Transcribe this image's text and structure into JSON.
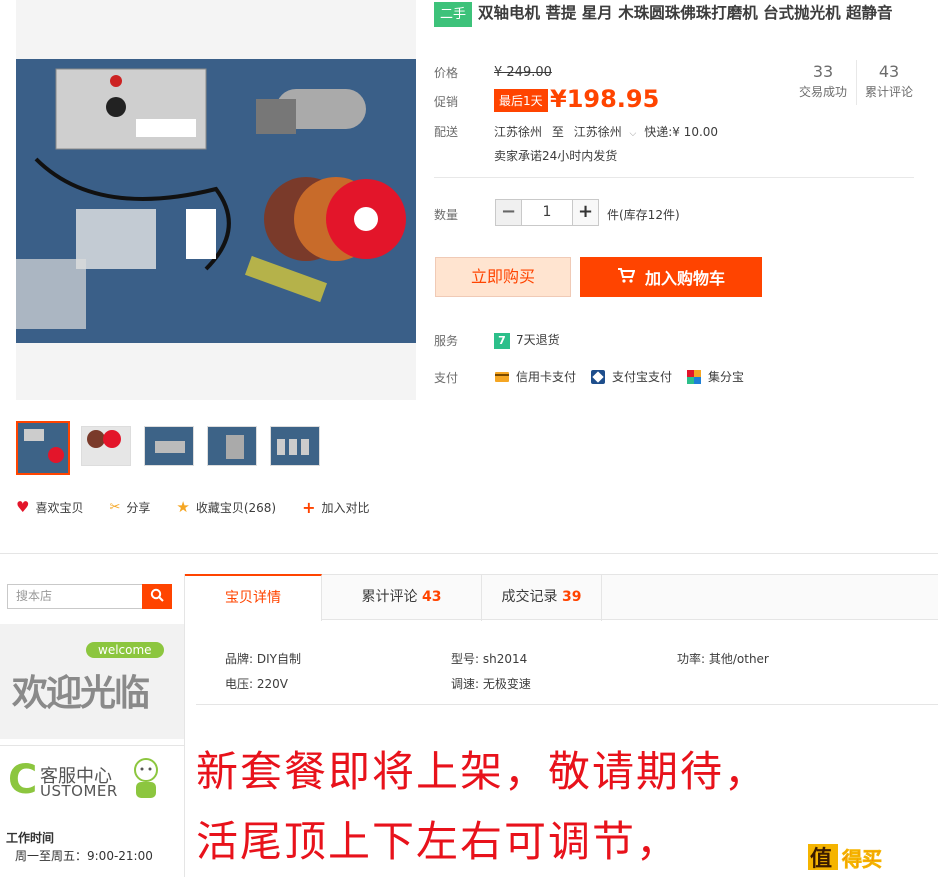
{
  "product": {
    "condition_badge": "二手",
    "title": "双轴电机 菩提 星月 木珠圆珠佛珠打磨机 台式抛光机 超静音",
    "price_label": "价格",
    "original_price": "¥ 249.00",
    "promo_label": "促销",
    "promo_tag": "最后1天",
    "promo_price": "¥198.95",
    "sales_count": "33",
    "sales_label": "交易成功",
    "reviews_count": "43",
    "reviews_label": "累计评论",
    "shipping_label": "配送",
    "ship_from": "江苏徐州",
    "ship_to_prefix": "至",
    "ship_to": "江苏徐州",
    "ship_fee": "快递:¥ 10.00",
    "ship_promise": "卖家承诺24小时内发货",
    "qty_label": "数量",
    "qty_minus": "−",
    "qty_value": "1",
    "qty_plus": "+",
    "qty_stock": "件(库存12件)",
    "buy_now": "立即购买",
    "add_to_cart": "加入购物车",
    "service_label": "服务",
    "service_icon_text": "7",
    "service_text": "7天退货",
    "pay_label": "支付",
    "pay_methods": [
      "信用卡支付",
      "支付宝支付",
      "集分宝"
    ]
  },
  "actions": [
    "喜欢宝贝",
    "分享",
    "收藏宝贝(268)",
    "加入对比"
  ],
  "shop": {
    "search_placeholder": "搜本店",
    "welcome_badge": "welcome",
    "welcome_text": "欢迎光临",
    "cs_title": "客服中心",
    "cs_sub": "USTOMER",
    "hours_title": "工作时间",
    "hours_weekday": "周一至周五：9:00-21:00"
  },
  "tabs": [
    {
      "label": "宝贝详情",
      "count": ""
    },
    {
      "label": "累计评论",
      "count": "43"
    },
    {
      "label": "成交记录",
      "count": "39"
    }
  ],
  "attributes": {
    "brand": "品牌: DIY自制",
    "model": "型号: sh2014",
    "power": "功率: 其他/other",
    "voltage": "电压: 220V",
    "speed": "调速: 无极变速"
  },
  "description": {
    "line1": "新套餐即将上架，敬请期待，",
    "line2": "活尾顶上下左右可调节，"
  },
  "watermark": "什么值得买",
  "colors": {
    "accent": "#ff4400",
    "green": "#3dc27a"
  }
}
